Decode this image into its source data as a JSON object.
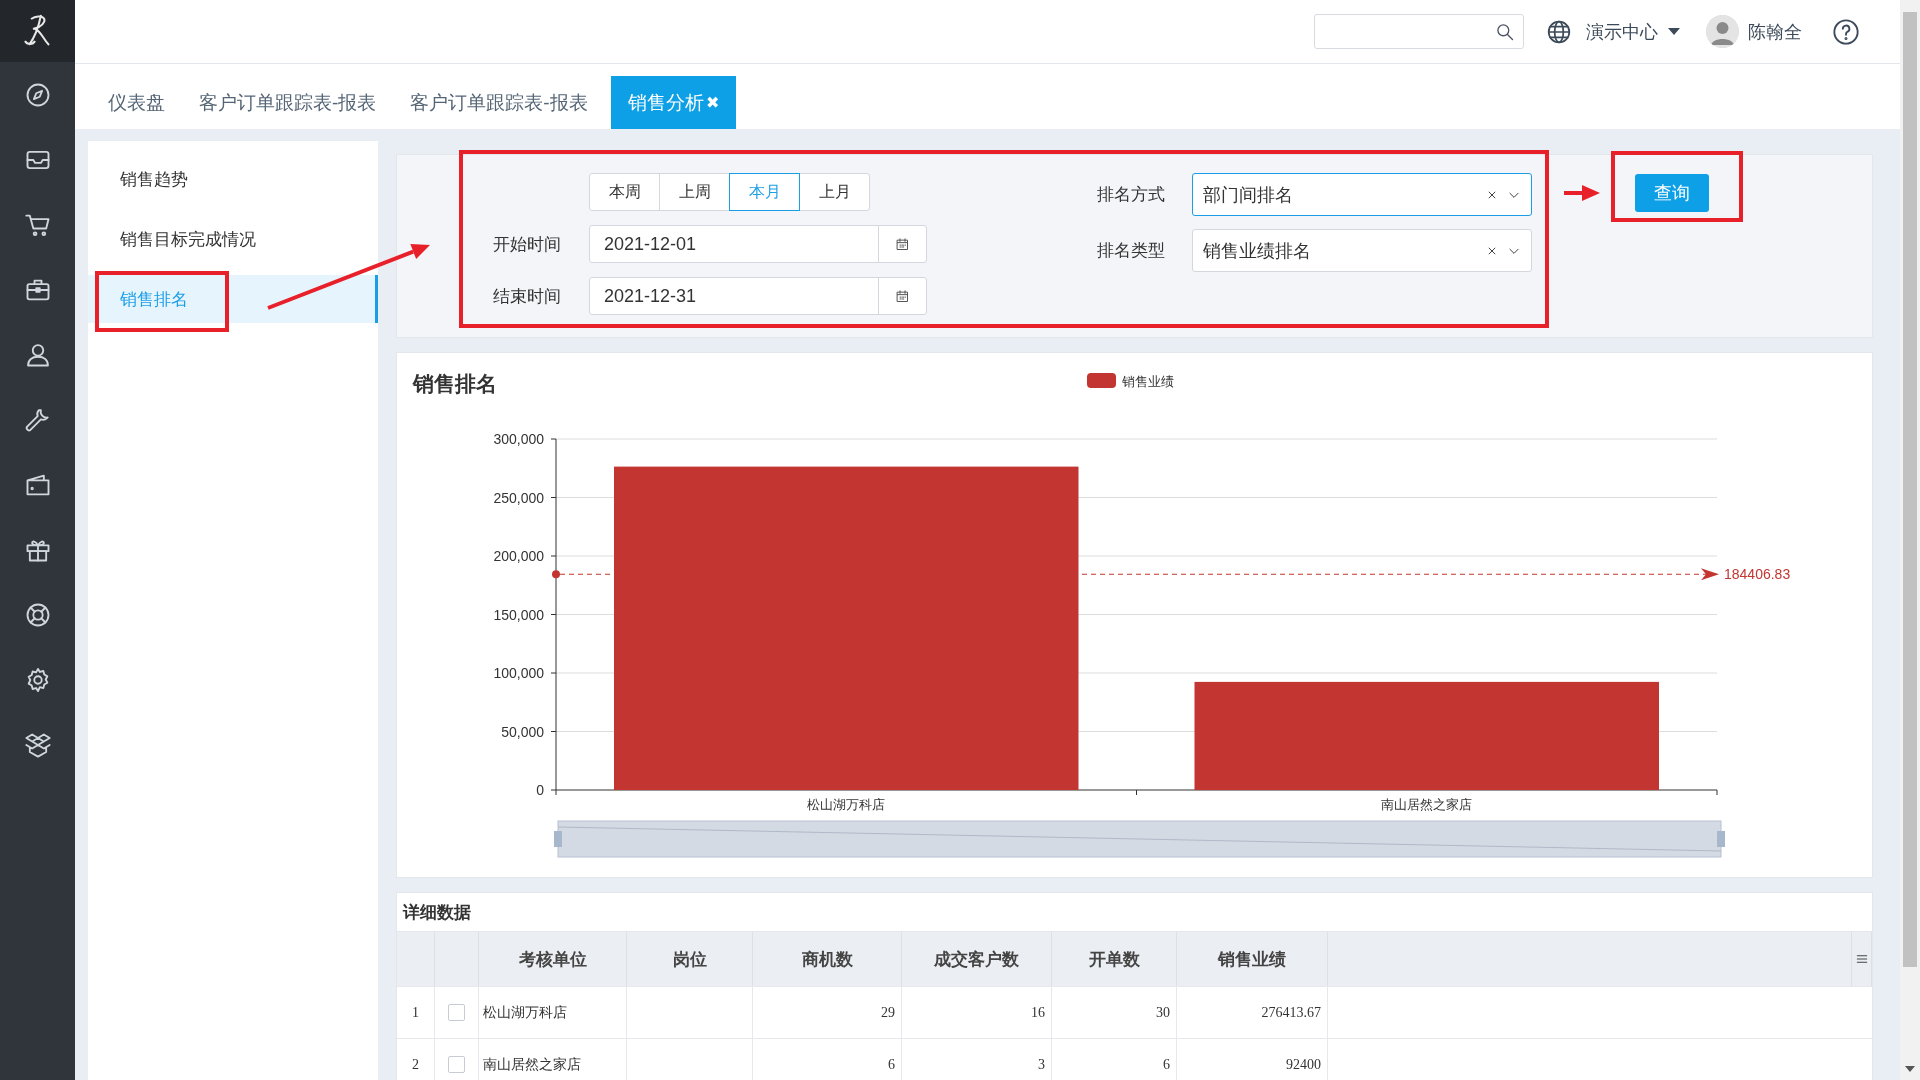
{
  "top_bar": {
    "org_menu": "演示中心",
    "user_name": "陈翰全"
  },
  "tabs": [
    {
      "label": "仪表盘",
      "selected": false
    },
    {
      "label": "客户订单跟踪表-报表",
      "selected": false
    },
    {
      "label": "客户订单跟踪表-报表",
      "selected": false
    },
    {
      "label": "销售分析",
      "selected": true,
      "close": "✖"
    }
  ],
  "side_menu": [
    {
      "label": "销售趋势",
      "selected": false
    },
    {
      "label": "销售目标完成情况",
      "selected": false
    },
    {
      "label": "销售排名",
      "selected": true
    }
  ],
  "filter": {
    "periods": [
      {
        "label": "本周",
        "selected": false
      },
      {
        "label": "上周",
        "selected": false
      },
      {
        "label": "本月",
        "selected": true
      },
      {
        "label": "上月",
        "selected": false
      }
    ],
    "start": {
      "label": "开始时间",
      "value": "2021-12-01"
    },
    "end": {
      "label": "结束时间",
      "value": "2021-12-31"
    },
    "rank_mode": {
      "label": "排名方式",
      "value": "部门间排名",
      "focused": true
    },
    "rank_type": {
      "label": "排名类型",
      "value": "销售业绩排名",
      "focused": false
    },
    "query_button": "查询"
  },
  "chart": {
    "title": "销售排名",
    "chart_data": {
      "type": "bar",
      "categories": [
        "松山湖万科店",
        "南山居然之家店"
      ],
      "series": [
        {
          "name": "销售业绩",
          "color": "#c23531",
          "values": [
            276400,
            92400
          ]
        }
      ],
      "grid": true,
      "ylim": [
        0,
        300000
      ],
      "yticks": [
        {
          "value": 0,
          "label": "0"
        },
        {
          "value": 50000,
          "label": "50,000"
        },
        {
          "value": 100000,
          "label": "100,000"
        },
        {
          "value": 150000,
          "label": "150,000"
        },
        {
          "value": 200000,
          "label": "200,000"
        },
        {
          "value": 250000,
          "label": "250,000"
        },
        {
          "value": 300000,
          "label": "300,000"
        }
      ],
      "ref_lines": [
        {
          "axis": "y",
          "value": 184406.83,
          "label": "184406.83"
        }
      ]
    }
  },
  "table": {
    "title": "详细数据",
    "columns": [
      "考核单位",
      "岗位",
      "商机数",
      "成交客户数",
      "开单数",
      "销售业绩"
    ],
    "rows": [
      {
        "index": "1",
        "checked": false,
        "unit": "松山湖万科店",
        "opportunities": "29",
        "customers": "16",
        "orders": "30",
        "sales": "276413.67"
      },
      {
        "index": "2",
        "checked": false,
        "unit": "南山居然之家店",
        "opportunities": "6",
        "customers": "3",
        "orders": "6",
        "sales": "92400"
      }
    ]
  }
}
